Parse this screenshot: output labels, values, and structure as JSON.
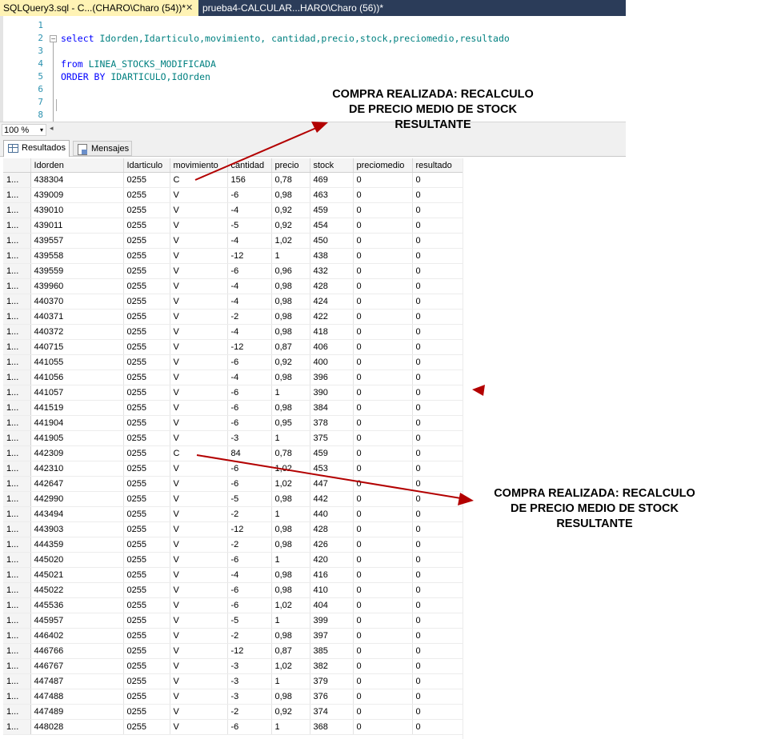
{
  "tabs": [
    {
      "label": "SQLQuery3.sql - C...(CHARO\\Charo (54))*",
      "close": "✕"
    },
    {
      "label": "prueba4-CALCULAR...HARO\\Charo (56))*"
    }
  ],
  "editor": {
    "line_numbers": [
      "1",
      "2",
      "3",
      "4",
      "5",
      "6",
      "7",
      "8"
    ],
    "lines": {
      "l2_kw": "select",
      "l2_cols": " Idorden,Idarticulo,movimiento, cantidad,precio,stock,preciomedio,resultado",
      "l4_kw": "from",
      "l4_table": " LINEA_STOCKS_MODIFICADA",
      "l5_kw": "ORDER BY",
      "l5_cols": " IDARTICULO,IdOrden"
    },
    "fold_symbol": "−"
  },
  "zoom": {
    "value": "100 %",
    "dropdown": "▾",
    "scroll_left": "◂"
  },
  "results_tabs": {
    "results": "Resultados",
    "messages": "Mensajes"
  },
  "grid": {
    "columns": [
      "Idorden",
      "Idarticulo",
      "movimiento",
      "cantidad",
      "precio",
      "stock",
      "preciomedio",
      "resultado"
    ],
    "rowhdr": "1...",
    "rows": [
      [
        "438304",
        "0255",
        "C",
        "156",
        "0,78",
        "469",
        "0",
        "0"
      ],
      [
        "439009",
        "0255",
        "V",
        "-6",
        "0,98",
        "463",
        "0",
        "0"
      ],
      [
        "439010",
        "0255",
        "V",
        "-4",
        "0,92",
        "459",
        "0",
        "0"
      ],
      [
        "439011",
        "0255",
        "V",
        "-5",
        "0,92",
        "454",
        "0",
        "0"
      ],
      [
        "439557",
        "0255",
        "V",
        "-4",
        "1,02",
        "450",
        "0",
        "0"
      ],
      [
        "439558",
        "0255",
        "V",
        "-12",
        "1",
        "438",
        "0",
        "0"
      ],
      [
        "439559",
        "0255",
        "V",
        "-6",
        "0,96",
        "432",
        "0",
        "0"
      ],
      [
        "439960",
        "0255",
        "V",
        "-4",
        "0,98",
        "428",
        "0",
        "0"
      ],
      [
        "440370",
        "0255",
        "V",
        "-4",
        "0,98",
        "424",
        "0",
        "0"
      ],
      [
        "440371",
        "0255",
        "V",
        "-2",
        "0,98",
        "422",
        "0",
        "0"
      ],
      [
        "440372",
        "0255",
        "V",
        "-4",
        "0,98",
        "418",
        "0",
        "0"
      ],
      [
        "440715",
        "0255",
        "V",
        "-12",
        "0,87",
        "406",
        "0",
        "0"
      ],
      [
        "441055",
        "0255",
        "V",
        "-6",
        "0,92",
        "400",
        "0",
        "0"
      ],
      [
        "441056",
        "0255",
        "V",
        "-4",
        "0,98",
        "396",
        "0",
        "0"
      ],
      [
        "441057",
        "0255",
        "V",
        "-6",
        "1",
        "390",
        "0",
        "0"
      ],
      [
        "441519",
        "0255",
        "V",
        "-6",
        "0,98",
        "384",
        "0",
        "0"
      ],
      [
        "441904",
        "0255",
        "V",
        "-6",
        "0,95",
        "378",
        "0",
        "0"
      ],
      [
        "441905",
        "0255",
        "V",
        "-3",
        "1",
        "375",
        "0",
        "0"
      ],
      [
        "442309",
        "0255",
        "C",
        "84",
        "0,78",
        "459",
        "0",
        "0"
      ],
      [
        "442310",
        "0255",
        "V",
        "-6",
        "1,02",
        "453",
        "0",
        "0"
      ],
      [
        "442647",
        "0255",
        "V",
        "-6",
        "1,02",
        "447",
        "0",
        "0"
      ],
      [
        "442990",
        "0255",
        "V",
        "-5",
        "0,98",
        "442",
        "0",
        "0"
      ],
      [
        "443494",
        "0255",
        "V",
        "-2",
        "1",
        "440",
        "0",
        "0"
      ],
      [
        "443903",
        "0255",
        "V",
        "-12",
        "0,98",
        "428",
        "0",
        "0"
      ],
      [
        "444359",
        "0255",
        "V",
        "-2",
        "0,98",
        "426",
        "0",
        "0"
      ],
      [
        "445020",
        "0255",
        "V",
        "-6",
        "1",
        "420",
        "0",
        "0"
      ],
      [
        "445021",
        "0255",
        "V",
        "-4",
        "0,98",
        "416",
        "0",
        "0"
      ],
      [
        "445022",
        "0255",
        "V",
        "-6",
        "0,98",
        "410",
        "0",
        "0"
      ],
      [
        "445536",
        "0255",
        "V",
        "-6",
        "1,02",
        "404",
        "0",
        "0"
      ],
      [
        "445957",
        "0255",
        "V",
        "-5",
        "1",
        "399",
        "0",
        "0"
      ],
      [
        "446402",
        "0255",
        "V",
        "-2",
        "0,98",
        "397",
        "0",
        "0"
      ],
      [
        "446766",
        "0255",
        "V",
        "-12",
        "0,87",
        "385",
        "0",
        "0"
      ],
      [
        "446767",
        "0255",
        "V",
        "-3",
        "1,02",
        "382",
        "0",
        "0"
      ],
      [
        "447487",
        "0255",
        "V",
        "-3",
        "1",
        "379",
        "0",
        "0"
      ],
      [
        "447488",
        "0255",
        "V",
        "-3",
        "0,98",
        "376",
        "0",
        "0"
      ],
      [
        "447489",
        "0255",
        "V",
        "-2",
        "0,92",
        "374",
        "0",
        "0"
      ],
      [
        "448028",
        "0255",
        "V",
        "-6",
        "1",
        "368",
        "0",
        "0"
      ]
    ]
  },
  "annotations": {
    "note1": [
      "COMPRA REALIZADA: RECALCULO",
      "DE PRECIO MEDIO DE STOCK",
      "RESULTANTE"
    ],
    "note2": [
      "COMPRA REALIZADA: RECALCULO",
      "DE PRECIO MEDIO DE STOCK",
      "RESULTANTE"
    ],
    "arrow_color": "#b30000"
  },
  "colors": {
    "keyword": "#0000ff",
    "identifier": "#008080",
    "line_number": "#2b91af",
    "active_tab": "#fff3b5",
    "tabbar": "#2b3c59"
  }
}
